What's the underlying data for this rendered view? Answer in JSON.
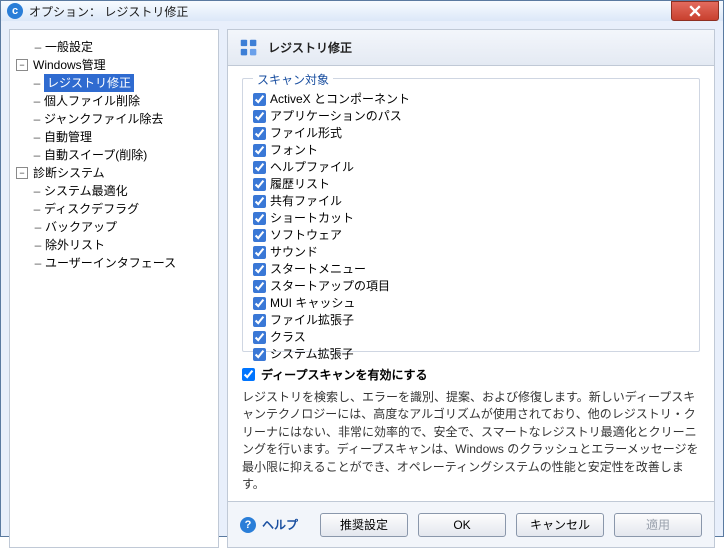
{
  "window": {
    "title": "オプション： レジストリ修正"
  },
  "tree": {
    "general": "一般設定",
    "windows_mgmt": "Windows管理",
    "windows_children": {
      "registry_fix": "レジストリ修正",
      "personal_file_delete": "個人ファイル削除",
      "junk_file_removal": "ジャンクファイル除去",
      "auto_mgmt": "自動管理",
      "auto_sweep": "自動スイープ(削除)"
    },
    "diagnostic": "診断システム",
    "diagnostic_children": {
      "system_optimize": "システム最適化",
      "disk_defrag": "ディスクデフラグ"
    },
    "backup": "バックアップ",
    "exclude_list": "除外リスト",
    "user_interface": "ユーザーインタフェース"
  },
  "panel": {
    "title": "レジストリ修正"
  },
  "scan_group": {
    "legend": "スキャン対象",
    "items": [
      "ActiveX とコンポーネント",
      "アプリケーションのパス",
      "ファイル形式",
      "フォント",
      "ヘルプファイル",
      "履歴リスト",
      "共有ファイル",
      "ショートカット",
      "ソフトウェア",
      "サウンド",
      "スタートメニュー",
      "スタートアップの項目",
      "MUI キャッシュ",
      "ファイル拡張子",
      "クラス",
      "システム拡張子"
    ]
  },
  "deepscan": {
    "label": "ディープスキャンを有効にする",
    "description": "レジストリを検索し、エラーを識別、提案、および修復します。新しいディープスキャンテクノロジーには、高度なアルゴリズムが使用されており、他のレジストリ・クリーナにはない、非常に効率的で、安全で、スマートなレジストリ最適化とクリーニングを行います。ディープスキャンは、Windows のクラッシュとエラーメッセージを最小限に抑えることができ、オペレーティングシステムの性能と安定性を改善します。"
  },
  "footer": {
    "help": "ヘルプ",
    "recommended": "推奨設定",
    "ok": "OK",
    "cancel": "キャンセル",
    "apply": "適用"
  },
  "chart_data": {
    "type": "table",
    "title": "スキャン対象 checklist (all checked)",
    "categories": [
      "ActiveX とコンポーネント",
      "アプリケーションのパス",
      "ファイル形式",
      "フォント",
      "ヘルプファイル",
      "履歴リスト",
      "共有ファイル",
      "ショートカット",
      "ソフトウェア",
      "サウンド",
      "スタートメニュー",
      "スタートアップの項目",
      "MUI キャッシュ",
      "ファイル拡張子",
      "クラス",
      "システム拡張子"
    ],
    "values": [
      1,
      1,
      1,
      1,
      1,
      1,
      1,
      1,
      1,
      1,
      1,
      1,
      1,
      1,
      1,
      1
    ]
  }
}
